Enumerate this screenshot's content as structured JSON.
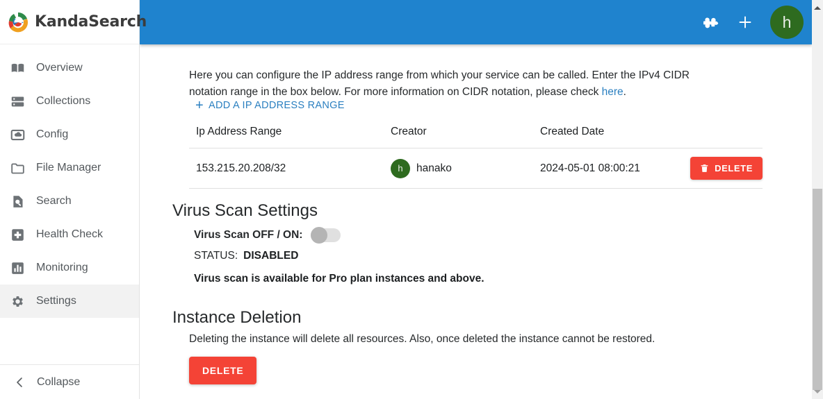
{
  "brand": {
    "name": "KandaSearch",
    "logo_icon": "kanda-swirl-logo",
    "colors": {
      "green": "#2e8b4a",
      "blue": "#1f83ce",
      "red": "#e03b2f",
      "orange": "#f0a020"
    }
  },
  "topbar": {
    "background": "#1f83ce",
    "puzzle_icon": "puzzle-piece-icon",
    "add_icon": "plus-icon",
    "avatar_initial": "h",
    "avatar_color": "#2e6b1f"
  },
  "sidebar": {
    "items": [
      {
        "label": "Overview",
        "icon": "book-open-icon",
        "active": false
      },
      {
        "label": "Collections",
        "icon": "server-icon",
        "active": false
      },
      {
        "label": "Config",
        "icon": "cloud-box-icon",
        "active": false
      },
      {
        "label": "File Manager",
        "icon": "folder-icon",
        "active": false
      },
      {
        "label": "Search",
        "icon": "doc-search-icon",
        "active": false
      },
      {
        "label": "Health Check",
        "icon": "plus-square-icon",
        "active": false
      },
      {
        "label": "Monitoring",
        "icon": "bar-chart-icon",
        "active": false
      },
      {
        "label": "Settings",
        "icon": "gear-icon",
        "active": true
      }
    ],
    "collapse": {
      "label": "Collapse",
      "icon": "chevron-left-icon"
    }
  },
  "main": {
    "intro": {
      "text_before": "Here you can configure the IP address range from which your service can be called. Enter the IPv4 CIDR notation range in the box below. For more information on CIDR notation, please check ",
      "link_text": "here",
      "text_after": "."
    },
    "add_range": {
      "label": "ADD A IP ADDRESS RANGE",
      "icon": "plus-icon"
    },
    "ip_table": {
      "headers": [
        "Ip Address Range",
        "Creator",
        "Created Date",
        ""
      ],
      "rows": [
        {
          "ip_range": "153.215.20.208/32",
          "creator": {
            "initial": "h",
            "name": "hanako"
          },
          "created_date": "2024-05-01 08:00:21",
          "action": {
            "label": "DELETE",
            "icon": "trash-icon",
            "color": "#f44336"
          }
        }
      ]
    },
    "virus_scan": {
      "title": "Virus Scan Settings",
      "toggle_label": "Virus Scan OFF / ON:",
      "toggle_state": "off",
      "status_label": "STATUS:",
      "status_value": "DISABLED",
      "note": "Virus scan is available for Pro plan instances and above."
    },
    "instance_deletion": {
      "title": "Instance Deletion",
      "description": "Deleting the instance will delete all resources. Also, once deleted the instance cannot be restored.",
      "button_label": "DELETE",
      "button_color": "#f44336"
    }
  },
  "scrollbar": {
    "up_icon": "scroll-up-arrow-icon",
    "down_icon": "scroll-down-arrow-icon"
  }
}
